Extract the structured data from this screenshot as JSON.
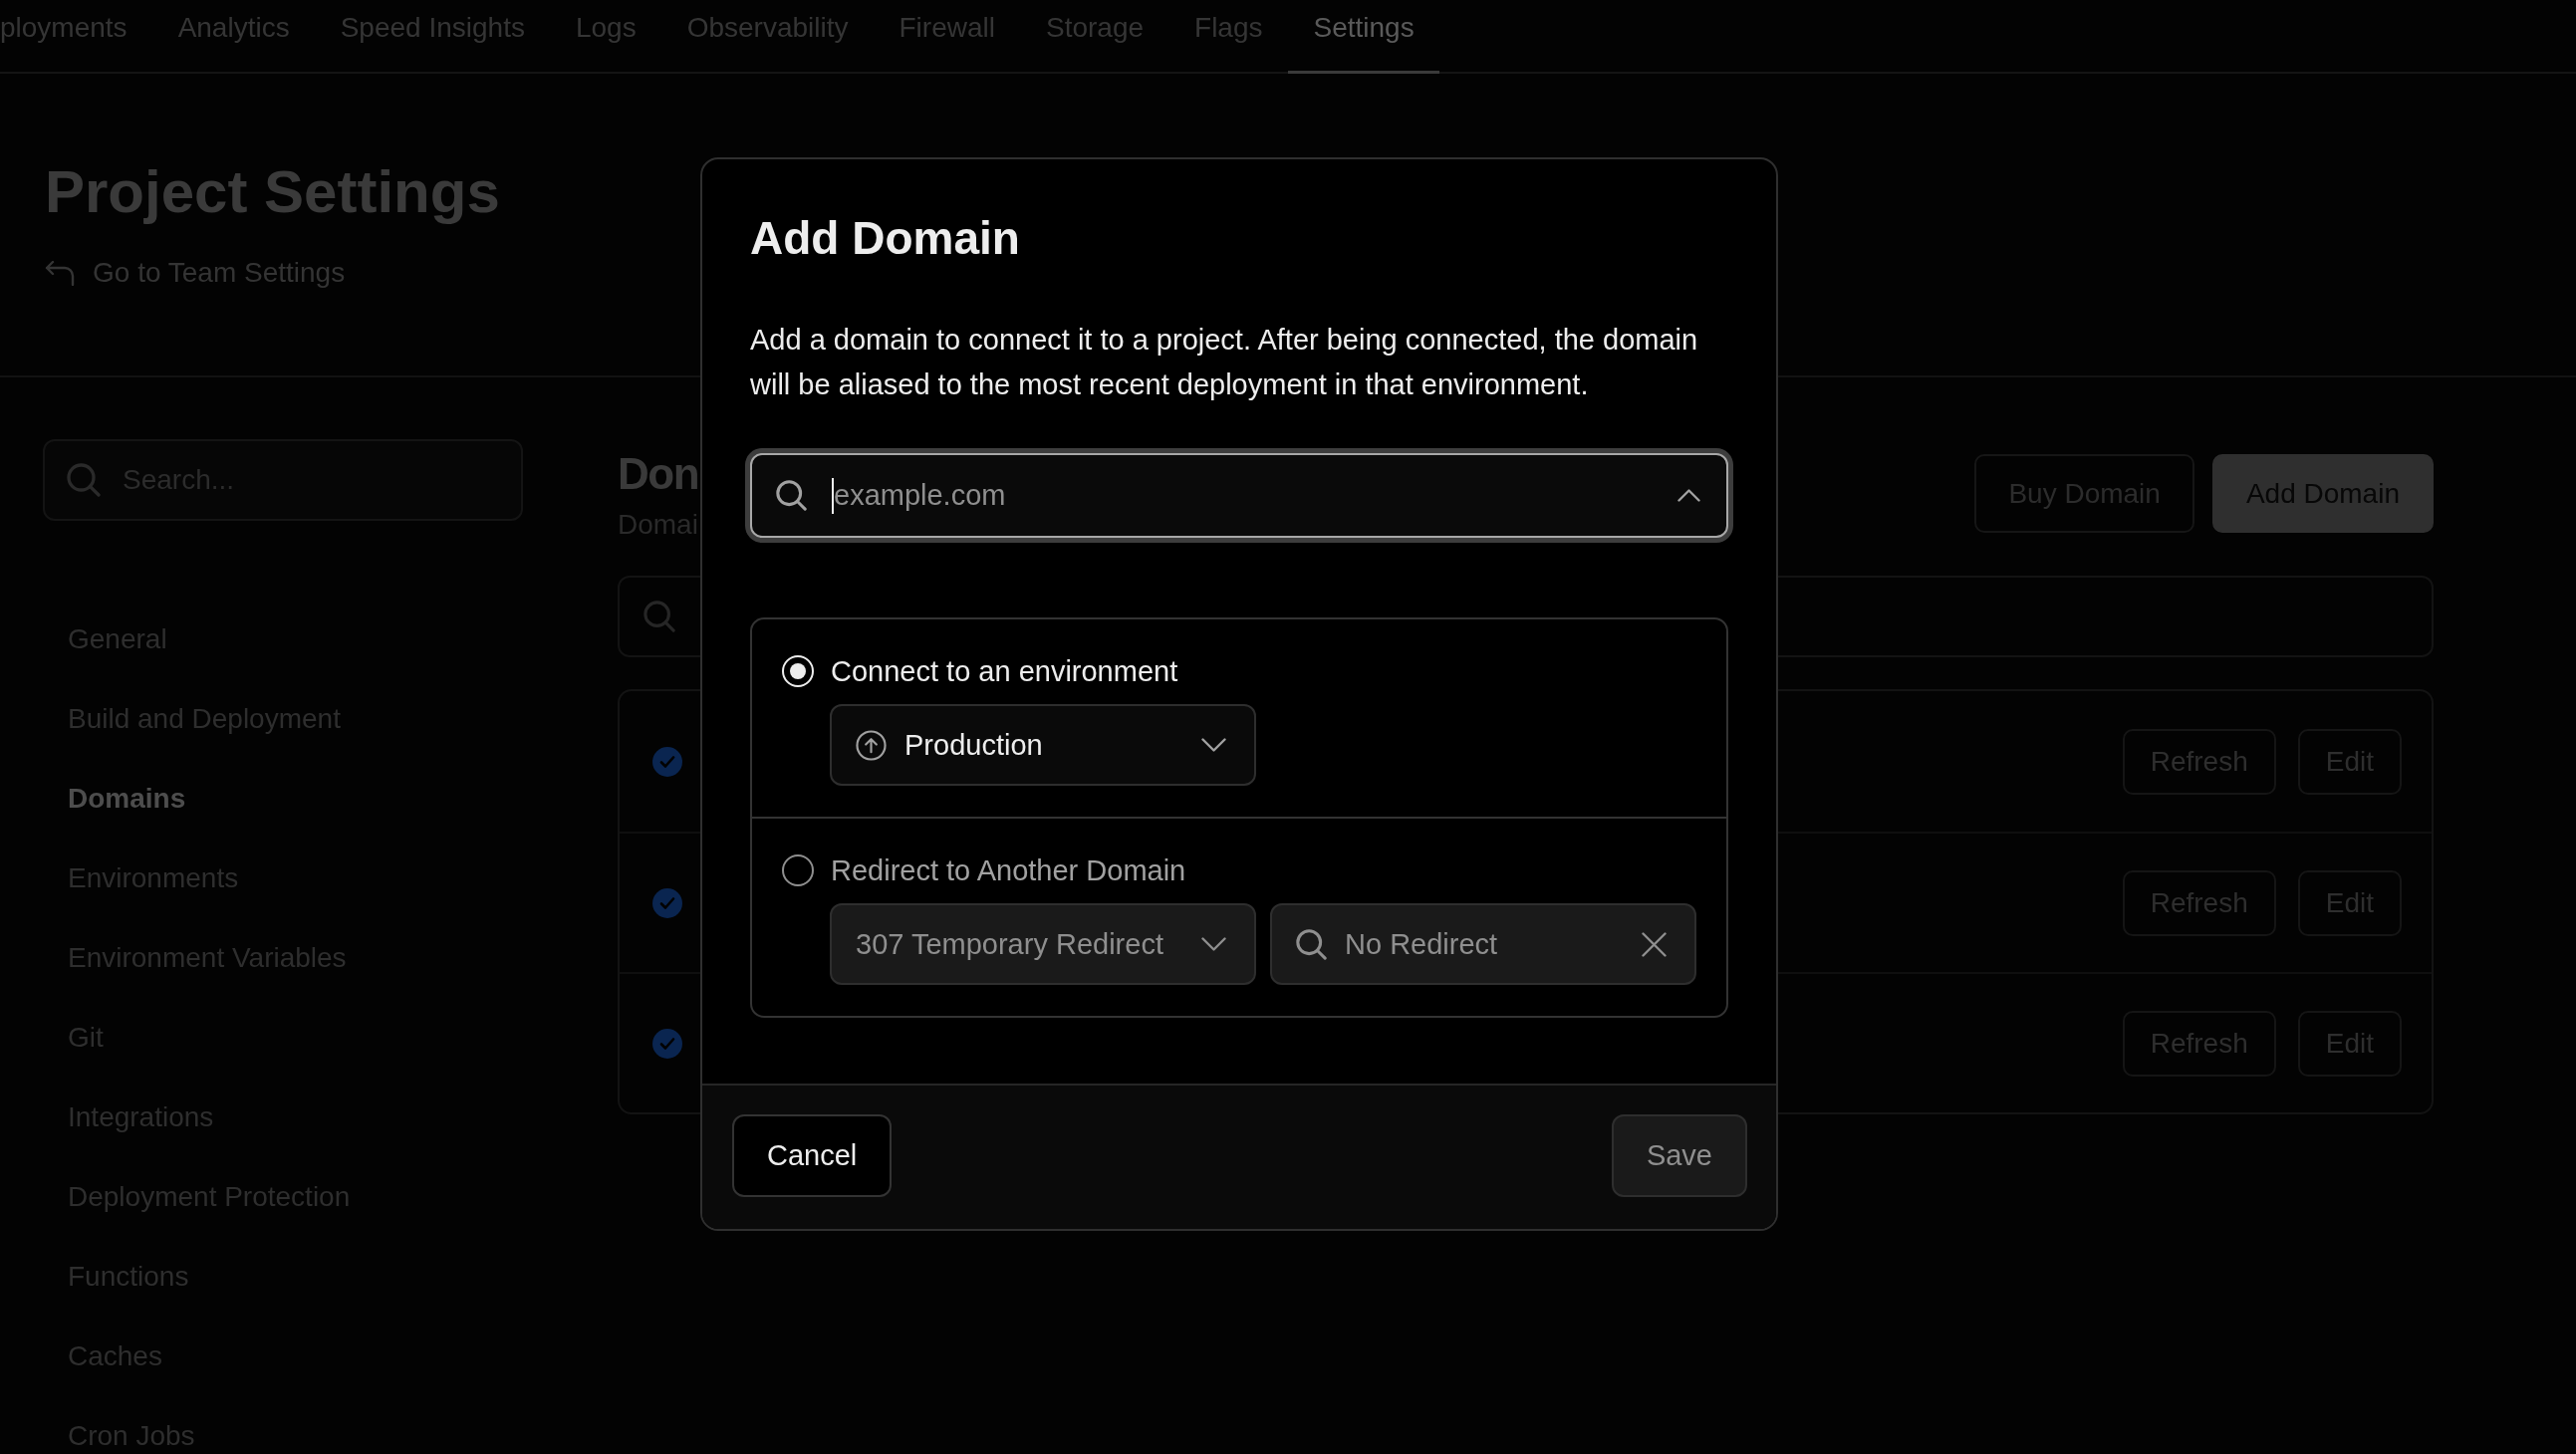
{
  "nav": {
    "tabs": [
      {
        "label": "ployments",
        "selected": false
      },
      {
        "label": "Analytics",
        "selected": false
      },
      {
        "label": "Speed Insights",
        "selected": false
      },
      {
        "label": "Logs",
        "selected": false
      },
      {
        "label": "Observability",
        "selected": false
      },
      {
        "label": "Firewall",
        "selected": false
      },
      {
        "label": "Storage",
        "selected": false
      },
      {
        "label": "Flags",
        "selected": false
      },
      {
        "label": "Settings",
        "selected": true
      }
    ]
  },
  "header": {
    "title": "Project Settings",
    "back_link": "Go to Team Settings"
  },
  "sidebar": {
    "search": {
      "placeholder": "Search..."
    },
    "items": [
      {
        "label": "General",
        "selected": false
      },
      {
        "label": "Build and Deployment",
        "selected": false
      },
      {
        "label": "Domains",
        "selected": true
      },
      {
        "label": "Environments",
        "selected": false
      },
      {
        "label": "Environment Variables",
        "selected": false
      },
      {
        "label": "Git",
        "selected": false
      },
      {
        "label": "Integrations",
        "selected": false
      },
      {
        "label": "Deployment Protection",
        "selected": false
      },
      {
        "label": "Functions",
        "selected": false
      },
      {
        "label": "Caches",
        "selected": false
      },
      {
        "label": "Cron Jobs",
        "selected": false
      }
    ]
  },
  "main": {
    "title": "Don",
    "subtitle": "Domai",
    "buttons": [
      {
        "label": "Buy Domain",
        "kind": "secondary"
      },
      {
        "label": "Add Domain",
        "kind": "primary"
      }
    ],
    "domains": [
      {
        "verified": true,
        "actions": [
          "Refresh",
          "Edit"
        ]
      },
      {
        "verified": true,
        "actions": [
          "Refresh",
          "Edit"
        ]
      },
      {
        "verified": true,
        "actions": [
          "Refresh",
          "Edit"
        ]
      }
    ]
  },
  "dialog": {
    "title": "Add Domain",
    "description": "Add a domain to connect it to a project. After being connected, the domain will be aliased to the most recent deployment in that environment.",
    "domain_input": {
      "placeholder": "example.com",
      "focused": true
    },
    "options": [
      {
        "kind": "environment",
        "label": "Connect to an environment",
        "selected": true,
        "environment": "Production"
      },
      {
        "kind": "redirect",
        "label": "Redirect to Another Domain",
        "selected": false,
        "status_code": "307 Temporary Redirect",
        "target": "No Redirect"
      }
    ],
    "footer": {
      "cancel": "Cancel",
      "save": {
        "label": "Save",
        "disabled": true
      }
    }
  }
}
